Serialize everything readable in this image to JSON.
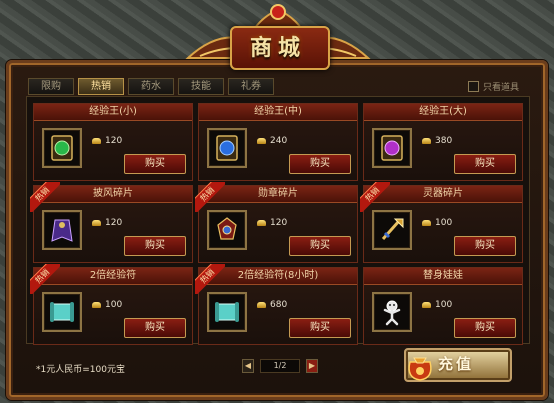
{
  "window": {
    "title": "商城"
  },
  "tabs": [
    {
      "label": "限购",
      "active": false
    },
    {
      "label": "热销",
      "active": true
    },
    {
      "label": "药水",
      "active": false
    },
    {
      "label": "技能",
      "active": false
    },
    {
      "label": "礼券",
      "active": false
    }
  ],
  "filter": {
    "label": "只看道具",
    "checked": false
  },
  "items": [
    {
      "name": "经验王(小)",
      "price": "120",
      "buy_label": "购买",
      "hot": false,
      "icon": "green-gem-book-icon"
    },
    {
      "name": "经验王(中)",
      "price": "240",
      "buy_label": "购买",
      "hot": false,
      "icon": "blue-gem-book-icon"
    },
    {
      "name": "经验王(大)",
      "price": "380",
      "buy_label": "购买",
      "hot": false,
      "icon": "purple-gem-book-icon"
    },
    {
      "name": "披风碎片",
      "price": "120",
      "buy_label": "购买",
      "hot": true,
      "hot_label": "热销",
      "icon": "cape-fragment-icon"
    },
    {
      "name": "勋章碎片",
      "price": "120",
      "buy_label": "购买",
      "hot": true,
      "hot_label": "热销",
      "icon": "medal-fragment-icon"
    },
    {
      "name": "灵器碎片",
      "price": "100",
      "buy_label": "购买",
      "hot": true,
      "hot_label": "热销",
      "icon": "spirit-weapon-fragment-icon"
    },
    {
      "name": "2倍经验符",
      "price": "100",
      "buy_label": "购买",
      "hot": true,
      "hot_label": "热销",
      "icon": "double-exp-scroll-icon"
    },
    {
      "name": "2倍经验符(8小时)",
      "price": "680",
      "buy_label": "购买",
      "hot": true,
      "hot_label": "热销",
      "icon": "double-exp-scroll-8h-icon"
    },
    {
      "name": "替身娃娃",
      "price": "100",
      "buy_label": "购买",
      "hot": false,
      "icon": "substitute-doll-icon"
    }
  ],
  "footer": {
    "exchange_note": "*1元人民币=100元宝",
    "page": "1/2",
    "recharge_label": "充值"
  },
  "colors": {
    "accent_gold": "#d9a347",
    "button_red": "#8a1e12",
    "header_red": "#7a2414"
  }
}
